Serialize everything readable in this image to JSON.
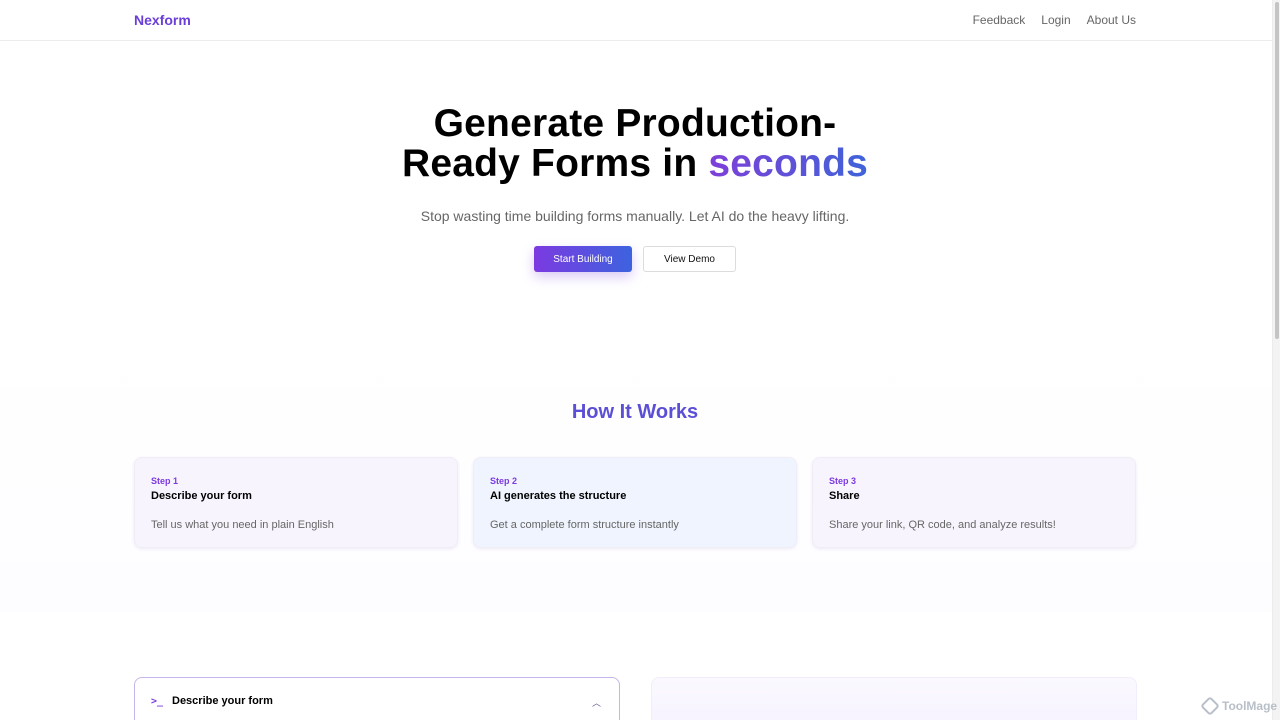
{
  "brand": "Nexform",
  "nav": [
    "Feedback",
    "Login",
    "About Us"
  ],
  "hero": {
    "title_part1": "Generate Production-",
    "title_part2": "Ready Forms in ",
    "title_accent": "seconds",
    "subtitle": "Stop wasting time building forms manually. Let AI do the heavy lifting."
  },
  "buttons": {
    "primary": "Start Building",
    "secondary": "View Demo"
  },
  "how_it_works": {
    "title": "How It Works",
    "steps": [
      {
        "label": "Step 1",
        "title": "Describe your form",
        "description": "Tell us what you need in plain English"
      },
      {
        "label": "Step 2",
        "title": "AI generates the structure",
        "description": "Get a complete form structure instantly"
      },
      {
        "label": "Step 3",
        "title": "Share",
        "description": "Share your link, QR code, and analyze results!"
      }
    ]
  },
  "describe_panel": {
    "icon": "terminal-icon",
    "title": "Describe your form",
    "chevron": "chevron-up-icon"
  },
  "watermark": "ToolMage",
  "colors": {
    "brand": "#6a3fd8",
    "accent_start": "#7f3fd8",
    "accent_end": "#3f63d8",
    "section_title": "#5b4fd5"
  }
}
